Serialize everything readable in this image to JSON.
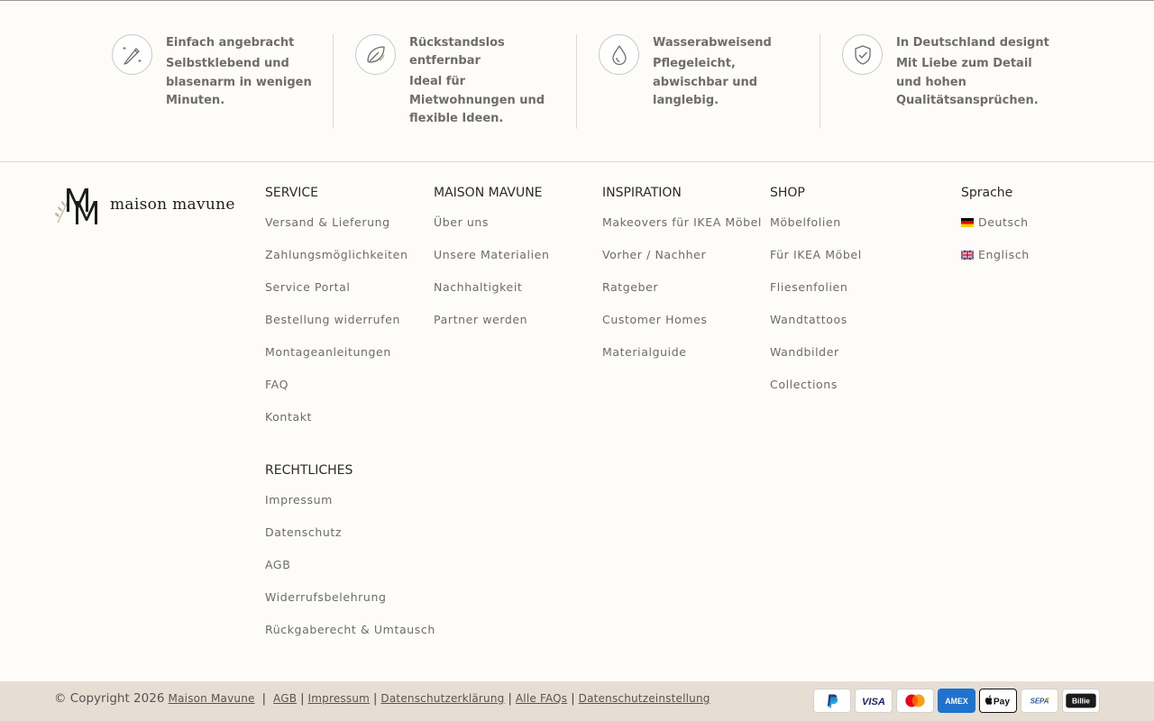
{
  "features": [
    {
      "icon": "pencil-icon",
      "title": "Einfach angebracht",
      "desc": "Selbstklebend und blasenarm in wenigen Minuten."
    },
    {
      "icon": "leaf-icon",
      "title": "Rückstandslos entfernbar",
      "desc": "Ideal für Mietwohnungen und flexible Ideen."
    },
    {
      "icon": "water-drop-icon",
      "title": "Wasserabweisend",
      "desc": "Pflegeleicht, abwischbar und langlebig."
    },
    {
      "icon": "shield-check-icon",
      "title": "In Deutschland designt",
      "desc": "Mit Liebe zum Detail und hohen Qualitätsansprüchen."
    }
  ],
  "brand": {
    "name": "maison mavune",
    "monogram": "MM"
  },
  "columns": {
    "service": {
      "heading": "SERVICE",
      "items": [
        "Versand & Lieferung",
        "Zahlungsmöglichkeiten",
        "Service Portal",
        "Bestellung widerrufen",
        "Montageanleitungen",
        "FAQ",
        "Kontakt"
      ]
    },
    "legal": {
      "heading": "RECHTLICHES",
      "items": [
        "Impressum",
        "Datenschutz",
        "AGB",
        "Widerrufsbelehrung",
        "Rückgaberecht & Umtausch"
      ]
    },
    "maison": {
      "heading": "MAISON MAVUNE",
      "items": [
        "Über uns",
        "Unsere Materialien",
        "Nachhaltigkeit",
        "Partner werden"
      ]
    },
    "inspiration": {
      "heading": "INSPIRATION",
      "items": [
        "Makeovers für IKEA Möbel",
        "Vorher / Nachher",
        "Ratgeber",
        "Customer Homes",
        "Materialguide"
      ]
    },
    "shop": {
      "heading": "SHOP",
      "items": [
        "Möbelfolien",
        "Für IKEA Möbel",
        "Fliesenfolien",
        "Wandtattoos",
        "Wandbilder",
        "Collections"
      ]
    },
    "language": {
      "heading": "Sprache",
      "items": [
        "Deutsch",
        "Englisch"
      ]
    }
  },
  "bottom": {
    "copyright": "© Copyright 2026",
    "brand_link": "Maison Mavune",
    "links": [
      "AGB",
      "Impressum",
      "Datenschutzerklärung",
      "Alle FAQs",
      "Datenschutzeinstellung"
    ],
    "payments": [
      "PayPal",
      "VISA",
      "Mastercard",
      "American Express",
      "Apple Pay",
      "SEPA",
      "Billie"
    ],
    "payment_text": {
      "visa": "VISA",
      "amex": "AMEX",
      "apple": "Pay",
      "sepa": "SEPA",
      "billie": "Billie"
    }
  },
  "colors": {
    "background": "#fdfcf8",
    "bottom_bar": "#e6ddd3",
    "feature_text": "#6f6d68",
    "link_text": "#6b6b6b"
  }
}
